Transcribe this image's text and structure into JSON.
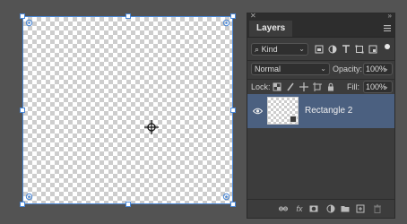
{
  "canvas": {
    "border_color": "#4a88d8"
  },
  "panel": {
    "tab_label": "Layers",
    "filter_select": {
      "value": "Kind"
    },
    "blend_select": {
      "value": "Normal"
    },
    "opacity": {
      "label": "Opacity:",
      "value": "100%"
    },
    "lock": {
      "label": "Lock:"
    },
    "fill": {
      "label": "Fill:",
      "value": "100%"
    },
    "layers": [
      {
        "name": "Rectangle 2",
        "visible": true,
        "selected": true
      }
    ],
    "selection_color": "#4b6080",
    "bottom_icons": [
      "link-layers-icon",
      "fx-icon",
      "mask-icon",
      "adjustment-icon",
      "group-folder-icon",
      "new-layer-icon",
      "trash-icon"
    ],
    "fx_text": "fx"
  }
}
